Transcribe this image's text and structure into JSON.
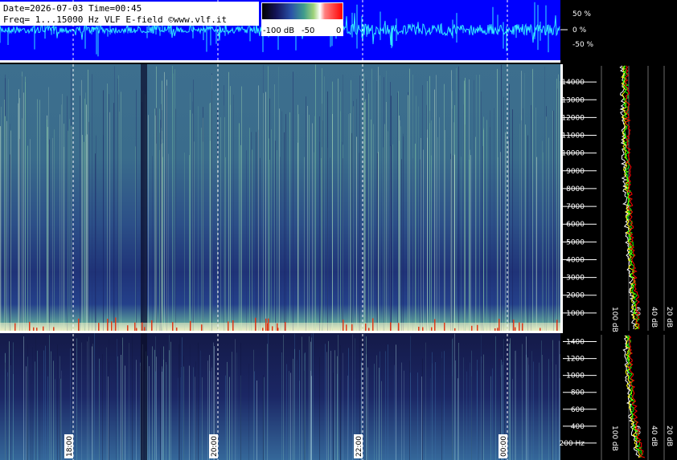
{
  "header": {
    "line1": "Date=2026-07-03 Time=00:45",
    "line2": "Freq= 1...15000 Hz   VLF E-field ©www.vlf.it"
  },
  "colorbar": {
    "labels": [
      "-100 dB",
      "-50",
      "0"
    ],
    "colors": [
      "#000000",
      "#14145a",
      "#2a52a8",
      "#3f9c8c",
      "#9fd37a",
      "#ffffff",
      "#ff8080",
      "#ff0000"
    ]
  },
  "chart_data": [
    {
      "type": "line",
      "title": "",
      "ylabel": "",
      "y_ticks": [
        "50 %",
        "0 %",
        "-50 %"
      ],
      "y_values": [
        50,
        0,
        -50
      ],
      "ylim": [
        -100,
        100
      ],
      "colors": {
        "background": "#0000ff",
        "trace": "#33e6ff",
        "grid": "#ffffff"
      }
    },
    {
      "type": "heatmap",
      "name": "spectrogram-upper",
      "y_ticks": [
        "1000",
        "2000",
        "3000",
        "4000",
        "5000",
        "6000",
        "7000",
        "8000",
        "9000",
        "10000",
        "11000",
        "12000",
        "13000",
        "14000"
      ],
      "y_values": [
        1000,
        2000,
        3000,
        4000,
        5000,
        6000,
        7000,
        8000,
        9000,
        10000,
        11000,
        12000,
        13000,
        14000
      ],
      "ylim": [
        0,
        15000
      ]
    },
    {
      "type": "heatmap",
      "name": "spectrogram-lower",
      "y_ticks": [
        "200 Hz",
        "400",
        "600",
        "800",
        "1000",
        "1200",
        "1400"
      ],
      "y_values": [
        200,
        400,
        600,
        800,
        1000,
        1200,
        1400
      ],
      "ylim": [
        0,
        1500
      ]
    },
    {
      "type": "line",
      "name": "spectrum-upper",
      "x_ticks": [
        "100 dB",
        "60",
        "40 dB",
        "20 dB"
      ],
      "series_colors": [
        "#ffffff",
        "#ffff00",
        "#00ff00",
        "#ff0000"
      ]
    },
    {
      "type": "line",
      "name": "spectrum-lower",
      "x_ticks": [
        "100 dB",
        "60",
        "40 dB",
        "20 dB"
      ],
      "series_colors": [
        "#ffffff",
        "#ffff00",
        "#00ff00",
        "#ff0000"
      ]
    }
  ],
  "time_axis": {
    "labels": [
      "18:00",
      "20:00",
      "22:00",
      "00:00"
    ],
    "label_color": "#000000",
    "label_bg": "#ffffff"
  }
}
